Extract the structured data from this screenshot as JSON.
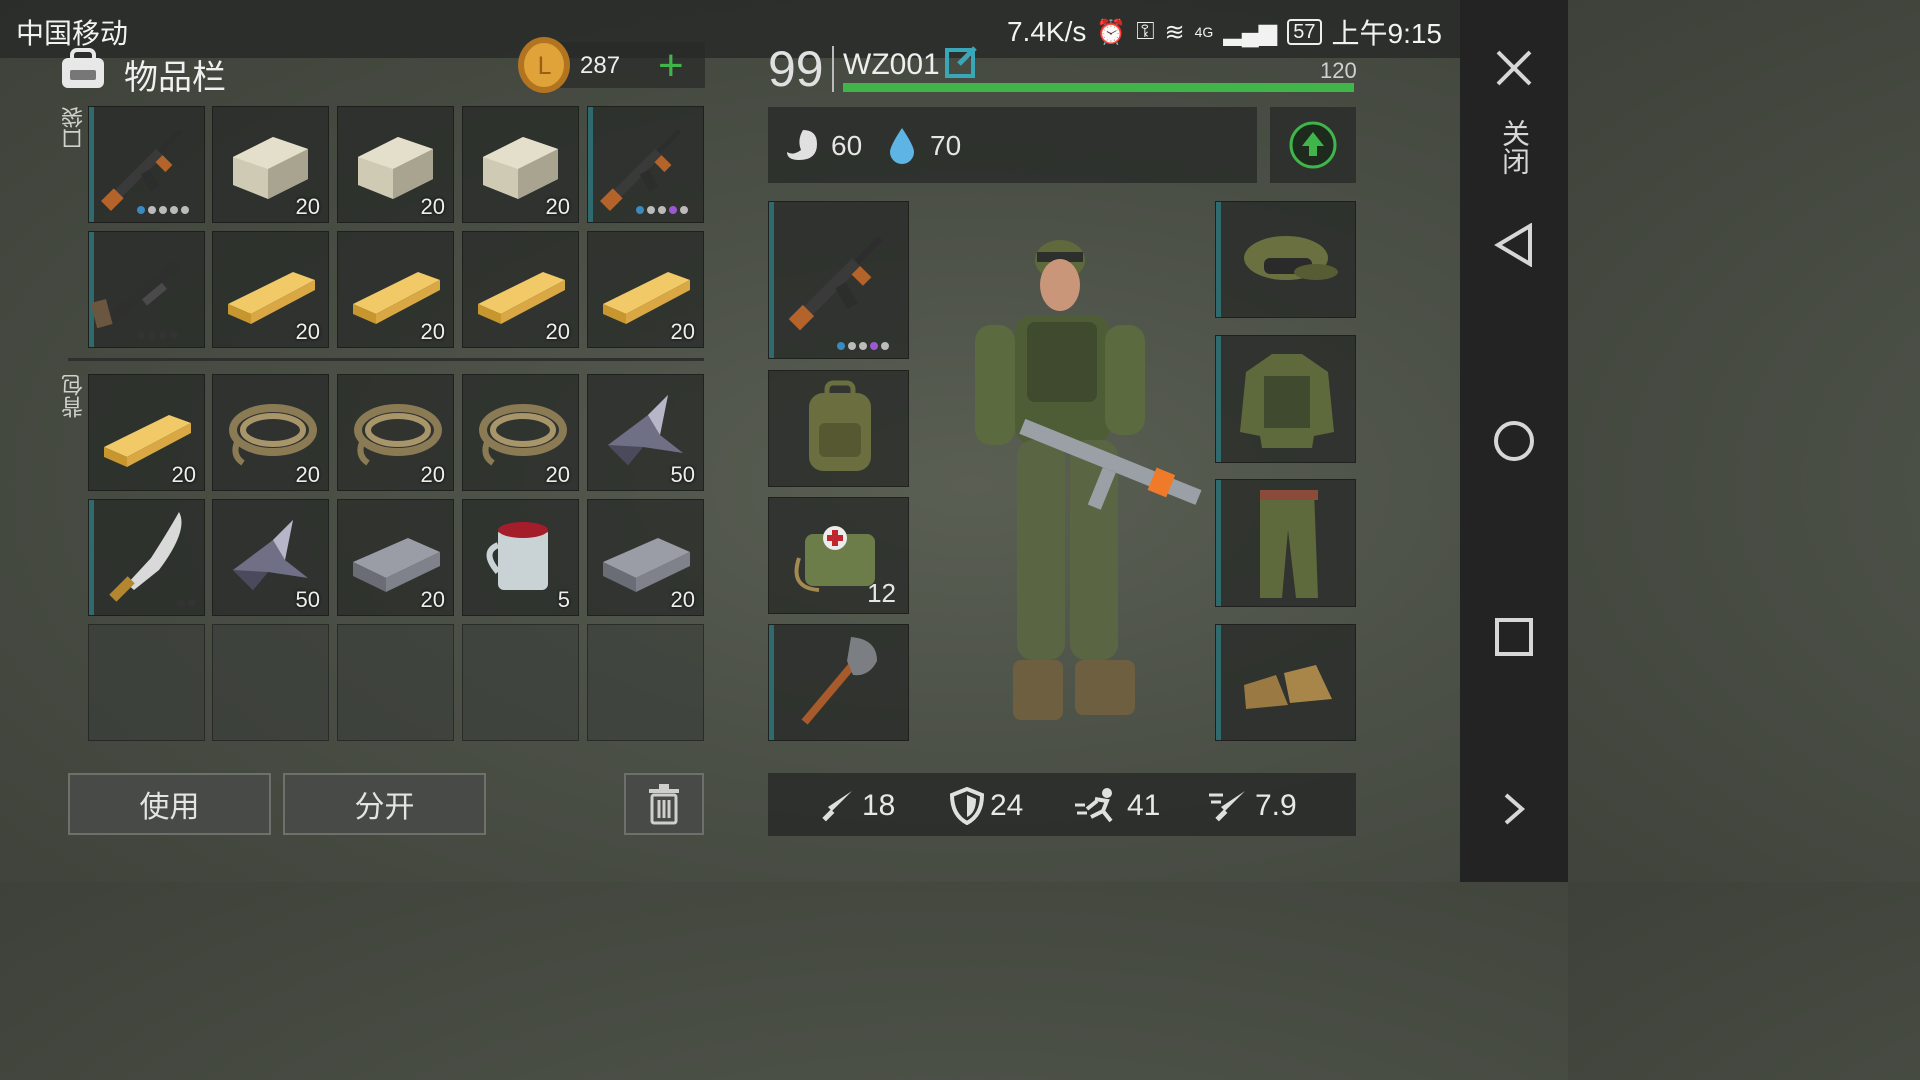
{
  "status": {
    "carrier": "中国移动",
    "speed": "7.4K/s",
    "network": "4G",
    "battery": "57",
    "time": "上午9:15"
  },
  "inventory": {
    "title": "物品栏",
    "coins": "287",
    "pockets_label": "口袋",
    "backpack_label": "背包",
    "pocket_counts": [
      "",
      "20",
      "20",
      "20",
      "",
      "",
      "20",
      "20",
      "20",
      "20"
    ],
    "backpack_counts": [
      "20",
      "20",
      "20",
      "20",
      "50",
      "",
      "50",
      "20",
      "5",
      "20"
    ],
    "use_label": "使用",
    "split_label": "分开"
  },
  "player": {
    "level": "99",
    "name": "WZ001",
    "xp_max": "120",
    "xp_fraction": 1.0,
    "hunger": "60",
    "thirst": "70"
  },
  "equipment": {
    "medkit_count": "12"
  },
  "stats": {
    "attack": "18",
    "defense": "24",
    "speed": "41",
    "attack_speed": "7.9"
  },
  "nav": {
    "close_label": "关闭"
  },
  "colors": {
    "accent_green": "#3fb54a",
    "teal_bar": "#2f6a6f",
    "coin": "#d4952e"
  }
}
